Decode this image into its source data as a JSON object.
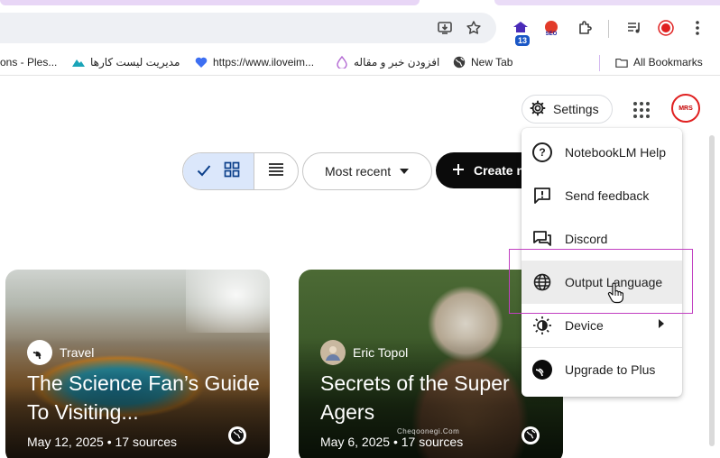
{
  "browser": {
    "toolbar_icons": [
      "install-icon",
      "star-icon"
    ],
    "extensions": [
      "extension-13-icon",
      "seo-icon",
      "puzzle-icon",
      "media-queue-icon",
      "profile-icon",
      "menu-kebab-icon"
    ],
    "extension_badge": "13",
    "seo_badge": "SEO",
    "bookmarks": [
      {
        "label": "ons - Ples...",
        "icon": "none"
      },
      {
        "label": "مدیریت لیست کارها",
        "icon": "mountain-icon"
      },
      {
        "label": "https://www.iloveim...",
        "icon": "heart-icon"
      },
      {
        "label": "افزودن خبر و مقاله",
        "icon": "drop-icon"
      },
      {
        "label": "New Tab",
        "icon": "globe-icon"
      }
    ],
    "all_bookmarks_label": "All Bookmarks"
  },
  "header": {
    "settings_label": "Settings",
    "avatar_text": "MRS"
  },
  "toolbar": {
    "sort_label": "Most recent",
    "create_label": "Create n"
  },
  "cards": [
    {
      "source": "Travel",
      "title": "The Science Fan’s Guide To Visiting...",
      "meta": "May 12, 2025 • 17 sources"
    },
    {
      "source": "Eric Topol",
      "title": "Secrets of the Super Agers",
      "meta": "May 6, 2025 • 17 sources"
    }
  ],
  "watermark": "Cheqoonegi.Com",
  "menu": {
    "items": [
      {
        "label": "NotebookLM Help",
        "icon": "help-icon"
      },
      {
        "label": "Send feedback",
        "icon": "feedback-icon"
      },
      {
        "label": "Discord",
        "icon": "discord-icon"
      },
      {
        "label": "Output Language",
        "icon": "globe-icon",
        "active": true
      },
      {
        "label": "Device",
        "icon": "brightness-icon",
        "has_submenu": true
      },
      {
        "label": "Upgrade to Plus",
        "icon": "plus-icon"
      }
    ]
  }
}
